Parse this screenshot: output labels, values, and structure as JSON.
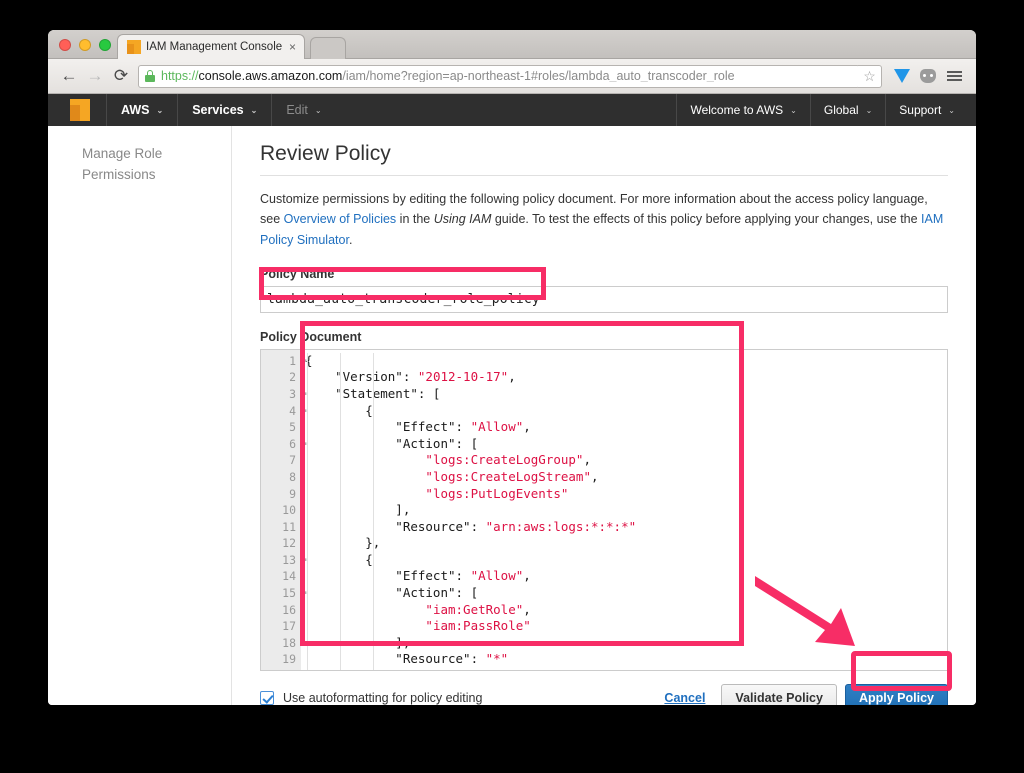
{
  "browser": {
    "tab": {
      "title": "IAM Management Console",
      "favicon": "aws-cube-icon",
      "close": "×"
    },
    "nav": {
      "back": "←",
      "forward": "→",
      "reload": "⟳",
      "star": "☆",
      "menu": "hamburger-menu-icon"
    },
    "url": {
      "scheme": "https://",
      "host": "console.aws.amazon.com",
      "path": "/iam/home?region=ap-northeast-1#roles/lambda_auto_transcoder_role"
    }
  },
  "aws_nav": {
    "logo": "aws-cube-logo",
    "items": [
      {
        "label": "AWS",
        "caret": "⌄"
      },
      {
        "label": "Services",
        "caret": "⌄"
      },
      {
        "label": "Edit",
        "caret": "⌄"
      }
    ],
    "right_items": [
      {
        "label": "Welcome to AWS",
        "caret": "⌄"
      },
      {
        "label": "Global",
        "caret": "⌄"
      },
      {
        "label": "Support",
        "caret": "⌄"
      }
    ]
  },
  "sidebar": {
    "heading": "Manage Role Permissions"
  },
  "main": {
    "title": "Review Policy",
    "intro": {
      "part1": "Customize permissions by editing the following policy document. For more information about the access policy language, see ",
      "link1": "Overview of Policies",
      "part2": " in the ",
      "italic1": "Using IAM",
      "part3": " guide. To test the effects of this policy before applying your changes, use the ",
      "link2": "IAM Policy Simulator",
      "part4": "."
    },
    "policy_name_label": "Policy Name",
    "policy_name_value": "lambda_auto_transcoder_role_policy",
    "policy_document_label": "Policy Document",
    "editor": {
      "line_numbers": [
        "1",
        "2",
        "3",
        "4",
        "5",
        "6",
        "7",
        "8",
        "9",
        "10",
        "11",
        "12",
        "13",
        "14",
        "15",
        "16",
        "17",
        "18",
        "19"
      ],
      "fold_lines": [
        1,
        3,
        4,
        6,
        13,
        15
      ],
      "lines": [
        "{",
        "    \"Version\": \"2012-10-17\",",
        "    \"Statement\": [",
        "        {",
        "            \"Effect\": \"Allow\",",
        "            \"Action\": [",
        "                \"logs:CreateLogGroup\",",
        "                \"logs:CreateLogStream\",",
        "                \"logs:PutLogEvents\"",
        "            ],",
        "            \"Resource\": \"arn:aws:logs:*:*:*\"",
        "        },",
        "        {",
        "            \"Effect\": \"Allow\",",
        "            \"Action\": [",
        "                \"iam:GetRole\",",
        "                \"iam:PassRole\"",
        "            ],",
        "            \"Resource\": \"*\""
      ]
    },
    "autoformat_label": "Use autoformatting for policy editing",
    "autoformat_checked": "checked",
    "cancel_label": "Cancel",
    "validate_label": "Validate Policy",
    "apply_label": "Apply Policy"
  },
  "annotations": {
    "highlight_color": "#f72d66",
    "arrow": "down-right-arrow"
  }
}
